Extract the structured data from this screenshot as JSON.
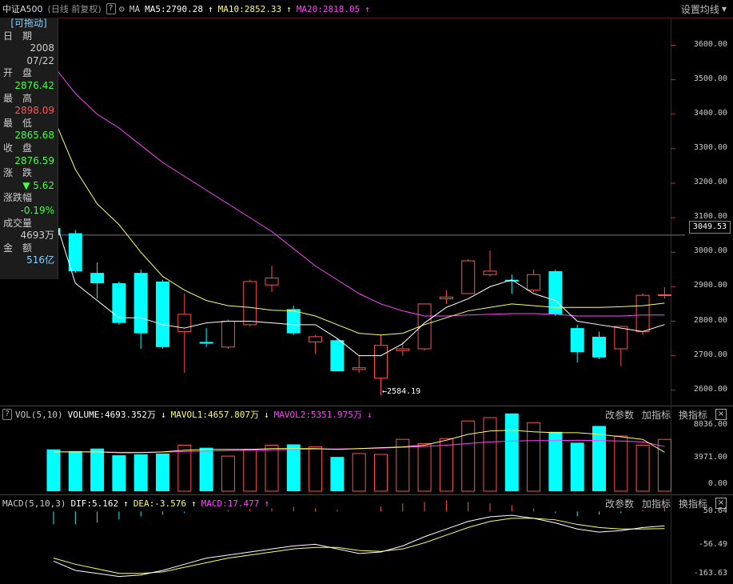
{
  "header": {
    "title": "中证A500",
    "mode": "(日线 前复权)",
    "help": "?",
    "gear_icon": "gear-icon",
    "ma_label": "MA",
    "ma5": "MA5:2790.28",
    "ma10": "MA10:2852.33",
    "ma20": "MA20:2818.05",
    "settings": "设置均线",
    "colors": {
      "ma5": "#ffffff",
      "ma10": "#ffff66",
      "ma20": "#ff44ff"
    }
  },
  "info_panel": {
    "drag": "[可拖动]",
    "date_label": "日　期",
    "year": "2008",
    "date": "07/22",
    "open_label": "开　盘",
    "open": "2876.42",
    "high_label": "最　高",
    "high": "2898.09",
    "low_label": "最　低",
    "low": "2865.68",
    "close_label": "收　盘",
    "close": "2876.59",
    "change_label": "涨　跌",
    "change": "▼ 5.62",
    "pct_label": "涨跌幅",
    "pct": "-0.19%",
    "vol_label": "成交量",
    "vol": "4693万",
    "amt_label": "金　额",
    "amt": "516亿"
  },
  "price_axis": [
    "3600.00",
    "3500.00",
    "3400.00",
    "3300.00",
    "3200.00",
    "3100.00",
    "3000.00",
    "2900.00",
    "2800.00",
    "2700.00",
    "2600.00"
  ],
  "current_price_tag": "3049.53",
  "low_marker": "2584.19",
  "volume_panel": {
    "help": "?",
    "title": "VOL(5,10)",
    "volume": "VOLUME:4693.352万",
    "mavol1": "MAVOL1:4657.807万",
    "mavol2": "MAVOL2:5351.975万",
    "btn_params": "改参数",
    "btn_add": "加指标",
    "btn_switch": "换指标",
    "close": "×",
    "axis": [
      "8036.00",
      "3971.00",
      "0.00"
    ]
  },
  "macd_panel": {
    "title": "MACD(5,10,3)",
    "dif": "DIF:5.162",
    "dea": "DEA:-3.576",
    "macd": "MACD:17.477",
    "btn_params": "改参数",
    "btn_add": "加指标",
    "btn_switch": "换指标",
    "close": "×",
    "axis": [
      "50.64",
      "-56.49",
      "-163.63"
    ]
  },
  "chart_data": {
    "type": "candlestick",
    "ohlc": [
      [
        3070,
        3080,
        3030,
        3050
      ],
      [
        3055,
        3065,
        2940,
        2945
      ],
      [
        2940,
        2970,
        2865,
        2910
      ],
      [
        2910,
        2915,
        2790,
        2795
      ],
      [
        2940,
        2950,
        2720,
        2765
      ],
      [
        2915,
        2920,
        2720,
        2725
      ],
      [
        2770,
        2880,
        2650,
        2820
      ],
      [
        2740,
        2780,
        2725,
        2735
      ],
      [
        2725,
        2805,
        2720,
        2800
      ],
      [
        2790,
        2920,
        2785,
        2915
      ],
      [
        2905,
        2960,
        2885,
        2925
      ],
      [
        2835,
        2845,
        2760,
        2765
      ],
      [
        2740,
        2760,
        2705,
        2755
      ],
      [
        2745,
        2750,
        2655,
        2655
      ],
      [
        2660,
        2700,
        2650,
        2665
      ],
      [
        2635,
        2760,
        2585,
        2730
      ],
      [
        2715,
        2740,
        2700,
        2720
      ],
      [
        2720,
        2850,
        2715,
        2850
      ],
      [
        2865,
        2890,
        2850,
        2870
      ],
      [
        2880,
        2980,
        2880,
        2975
      ],
      [
        2935,
        3005,
        2930,
        2945
      ],
      [
        2920,
        2935,
        2880,
        2915
      ],
      [
        2890,
        2950,
        2885,
        2935
      ],
      [
        2945,
        2950,
        2815,
        2820
      ],
      [
        2780,
        2790,
        2680,
        2710
      ],
      [
        2755,
        2770,
        2690,
        2695
      ],
      [
        2720,
        2780,
        2670,
        2785
      ],
      [
        2770,
        2880,
        2760,
        2875
      ],
      [
        2876.42,
        2898.09,
        2865.68,
        2876.59
      ]
    ],
    "ma5": [
      3110,
      2910,
      2860,
      2810,
      2810,
      2790,
      2780,
      2795,
      2800,
      2800,
      2795,
      2790,
      2790,
      2750,
      2700,
      2700,
      2735,
      2795,
      2840,
      2865,
      2900,
      2920,
      2880,
      2860,
      2800,
      2790,
      2780,
      2770,
      2790.28
    ],
    "ma10": [
      3390,
      3240,
      3140,
      3080,
      3000,
      2930,
      2890,
      2860,
      2845,
      2840,
      2832,
      2830,
      2815,
      2790,
      2765,
      2760,
      2765,
      2790,
      2810,
      2830,
      2840,
      2850,
      2845,
      2840,
      2840,
      2840,
      2842,
      2845,
      2852.33
    ],
    "ma20": [
      3540,
      3460,
      3400,
      3360,
      3310,
      3260,
      3220,
      3180,
      3140,
      3100,
      3060,
      3010,
      2960,
      2920,
      2880,
      2850,
      2830,
      2815,
      2815,
      2818,
      2820,
      2822,
      2822,
      2820,
      2815,
      2815,
      2815,
      2818,
      2818.05
    ],
    "volume": [
      5000,
      4800,
      5100,
      4300,
      4400,
      4500,
      5500,
      5200,
      4200,
      5000,
      5500,
      5600,
      5300,
      4100,
      4500,
      4400,
      6200,
      5700,
      6300,
      8400,
      8800,
      9300,
      8200,
      7100,
      5800,
      7800,
      6600,
      5500,
      6200
    ],
    "mavol1": [
      4700,
      4700,
      4700,
      4600,
      4600,
      4700,
      4900,
      5000,
      5000,
      5000,
      5100,
      5100,
      5100,
      5000,
      5100,
      5200,
      5300,
      5500,
      6100,
      6800,
      7200,
      7300,
      7100,
      7000,
      7000,
      6800,
      6500,
      6200,
      4657.807
    ],
    "mavol2": [
      4700,
      4700,
      4700,
      4650,
      4650,
      4680,
      4750,
      4800,
      4850,
      4900,
      4950,
      5000,
      5050,
      5050,
      5100,
      5150,
      5250,
      5350,
      5500,
      5700,
      5900,
      6000,
      6050,
      6050,
      6100,
      6050,
      6000,
      5900,
      5351.975
    ],
    "macd_hist": [
      -40,
      -40,
      -35,
      -25,
      -15,
      -10,
      -5,
      0,
      5,
      8,
      10,
      15,
      10,
      5,
      0,
      15,
      25,
      30,
      35,
      30,
      25,
      20,
      10,
      -5,
      -15,
      -10,
      -5,
      5,
      17.477
    ],
    "dif": [
      -110,
      -140,
      -150,
      -160,
      -155,
      -140,
      -120,
      -100,
      -90,
      -80,
      -70,
      -60,
      -55,
      -70,
      -85,
      -80,
      -60,
      -30,
      -5,
      20,
      35,
      40,
      30,
      15,
      -5,
      -15,
      -10,
      0,
      5.162
    ],
    "dea": [
      -100,
      -120,
      -135,
      -150,
      -150,
      -145,
      -130,
      -115,
      -100,
      -90,
      -80,
      -70,
      -65,
      -65,
      -75,
      -78,
      -70,
      -50,
      -25,
      0,
      20,
      30,
      30,
      25,
      10,
      0,
      -5,
      -5,
      -3.576
    ],
    "price_ylim": [
      2560,
      3680
    ],
    "volume_ylim": [
      0,
      8036
    ],
    "macd_ylim": [
      -163.63,
      50.64
    ],
    "grid": false
  }
}
